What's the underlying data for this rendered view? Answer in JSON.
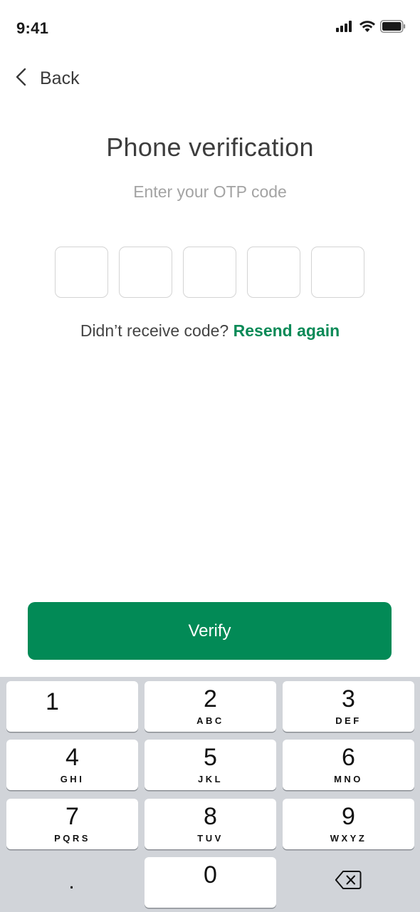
{
  "status": {
    "time": "9:41"
  },
  "header": {
    "back_label": "Back"
  },
  "main": {
    "title": "Phone verification",
    "subtitle": "Enter your OTP code",
    "otp_values": [
      "",
      "",
      "",
      "",
      ""
    ],
    "resend_prompt": "Didn’t receive code?",
    "resend_link": "Resend again",
    "verify_label": "Verify"
  },
  "keypad": {
    "keys": [
      {
        "digit": "1",
        "letters": ""
      },
      {
        "digit": "2",
        "letters": "ABC"
      },
      {
        "digit": "3",
        "letters": "DEF"
      },
      {
        "digit": "4",
        "letters": "GHI"
      },
      {
        "digit": "5",
        "letters": "JKL"
      },
      {
        "digit": "6",
        "letters": "MNO"
      },
      {
        "digit": "7",
        "letters": "PQRS"
      },
      {
        "digit": "8",
        "letters": "TUV"
      },
      {
        "digit": "9",
        "letters": "WXYZ"
      },
      {
        "digit": "0",
        "letters": ""
      }
    ],
    "dot_label": "."
  },
  "colors": {
    "accent": "#028a56",
    "link": "#0a8a57",
    "keypad_bg": "#d1d4d9"
  },
  "icons": {
    "back": "chevron-left-icon",
    "signal": "cellular-signal-icon",
    "wifi": "wifi-icon",
    "battery": "battery-icon",
    "delete": "backspace-icon"
  }
}
